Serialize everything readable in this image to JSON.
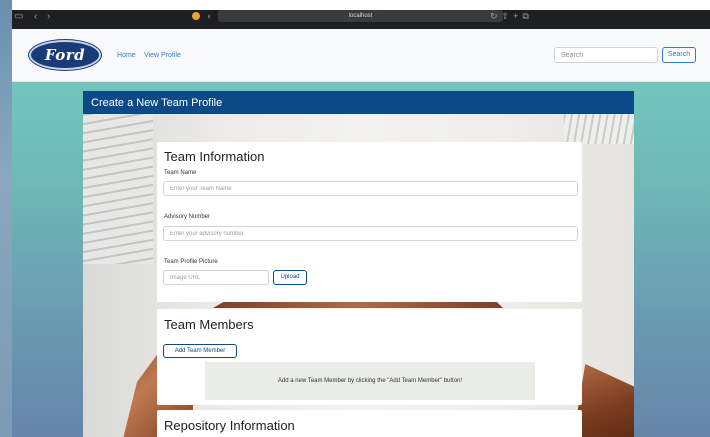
{
  "browser": {
    "url": "localhost"
  },
  "navbar": {
    "logo_text": "Ford",
    "links": [
      "Home",
      "View Profile"
    ],
    "search_placeholder": "Search",
    "search_button": "Search"
  },
  "card": {
    "title": "Create a New Team Profile"
  },
  "team_info": {
    "title": "Team Information",
    "team_name_label": "Team Name",
    "team_name_placeholder": "Enter your Team Name",
    "advisory_label": "Advisory Number",
    "advisory_placeholder": "Enter your advisory number",
    "picture_label": "Team Profile Picture",
    "picture_placeholder": "Image URL",
    "upload_button": "Upload"
  },
  "team_members": {
    "title": "Team Members",
    "add_button": "Add Team Member",
    "empty_message": "Add a new Team Member by clicking the \"Add Team Member\" button!"
  },
  "repository": {
    "title": "Repository Information"
  },
  "colors": {
    "header_blue": "#0b4a86",
    "link_blue": "#2f7bd0",
    "empty_panel": "#e9ece7"
  }
}
